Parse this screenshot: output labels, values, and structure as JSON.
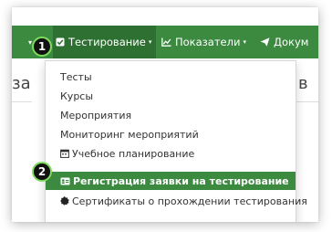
{
  "navbar": {
    "items": [
      {
        "label": "Тестирование",
        "icon": "checkbox-icon"
      },
      {
        "label": "Показатели",
        "icon": "chart-icon"
      },
      {
        "label": "Докум",
        "icon": "paper-plane-icon"
      }
    ]
  },
  "background_text": {
    "left": "за",
    "right": "в"
  },
  "dropdown": {
    "items": [
      {
        "label": "Тесты"
      },
      {
        "label": "Курсы"
      },
      {
        "label": "Мероприятия"
      },
      {
        "label": "Мониторинг мероприятий"
      },
      {
        "label": "Учебное планирование",
        "icon": "calendar-icon"
      },
      {
        "label": "Регистрация заявки на тестирование",
        "icon": "id-card-icon",
        "active": true
      },
      {
        "label": "Сертификаты о прохождении тестирования",
        "icon": "certificate-icon"
      }
    ]
  },
  "annotations": {
    "step1": "1",
    "step2": "2"
  },
  "colors": {
    "navbar": "#3b8a40",
    "navbar_active": "#2e7031",
    "menu_active": "#3b8a40",
    "badge_ring": "#7ddc5c"
  }
}
